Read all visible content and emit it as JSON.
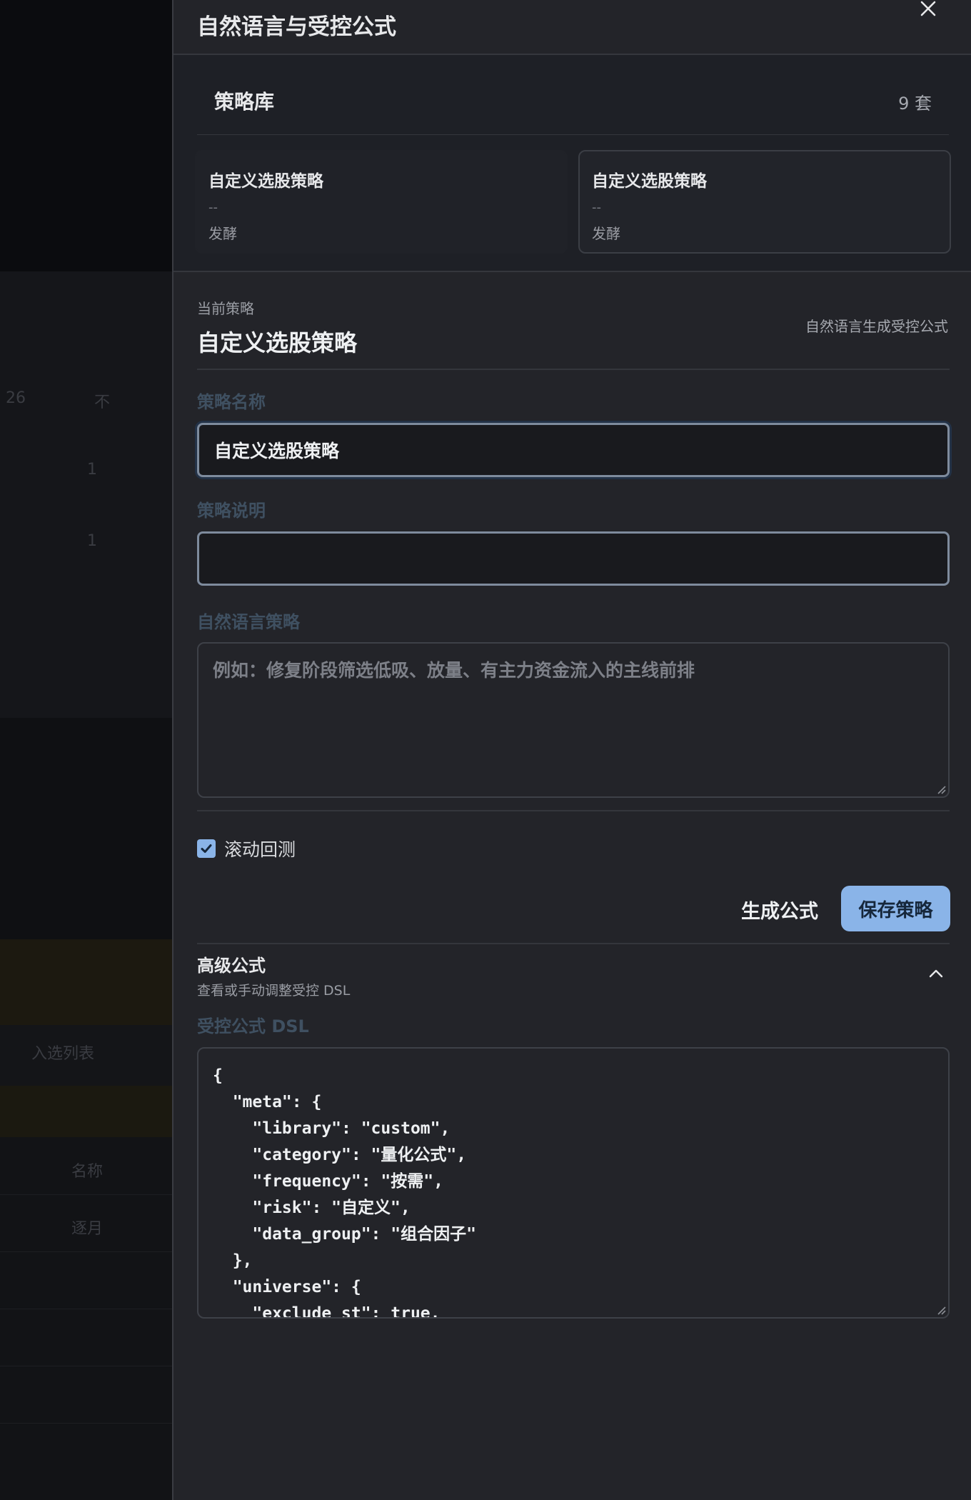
{
  "drawer": {
    "title": "自然语言与受控公式"
  },
  "library": {
    "title": "策略库",
    "count": "9 套",
    "cards": [
      {
        "name": "自定义选股策略",
        "description": "--",
        "category": "发酵"
      },
      {
        "name": "自定义选股策略",
        "description": "--",
        "category": "发酵"
      }
    ]
  },
  "current": {
    "label": "当前策略",
    "name": "自定义选股策略",
    "hint": "自然语言生成受控公式"
  },
  "form": {
    "name_label": "策略名称",
    "name_value": "自定义选股策略",
    "desc_label": "策略说明",
    "desc_value": "",
    "nl_label": "自然语言策略",
    "nl_placeholder": "例如：修复阶段筛选低吸、放量、有主力资金流入的主线前排",
    "rolling_backtest_label": "滚动回测",
    "rolling_backtest_checked": true
  },
  "actions": {
    "generate_label": "生成公式",
    "save_label": "保存策略"
  },
  "advanced": {
    "title": "高级公式",
    "subtitle": "查看或手动调整受控 DSL",
    "dsl_label": "受控公式 DSL",
    "dsl_text": "{\n  \"meta\": {\n    \"library\": \"custom\",\n    \"category\": \"量化公式\",\n    \"frequency\": \"按需\",\n    \"risk\": \"自定义\",\n    \"data_group\": \"组合因子\"\n  },\n  \"universe\": {\n    \"exclude_st\": true,"
  },
  "background": {
    "texts": [
      "26",
      "不",
      "1",
      "1",
      "入选列表",
      "名称",
      "逐月"
    ]
  },
  "colors": {
    "accent": "#8ab4e8",
    "panel": "#232429",
    "label_muted": "#3f5061"
  },
  "icons": {
    "close": "close-icon",
    "collapse": "chevron-up-icon",
    "check": "check-icon"
  }
}
